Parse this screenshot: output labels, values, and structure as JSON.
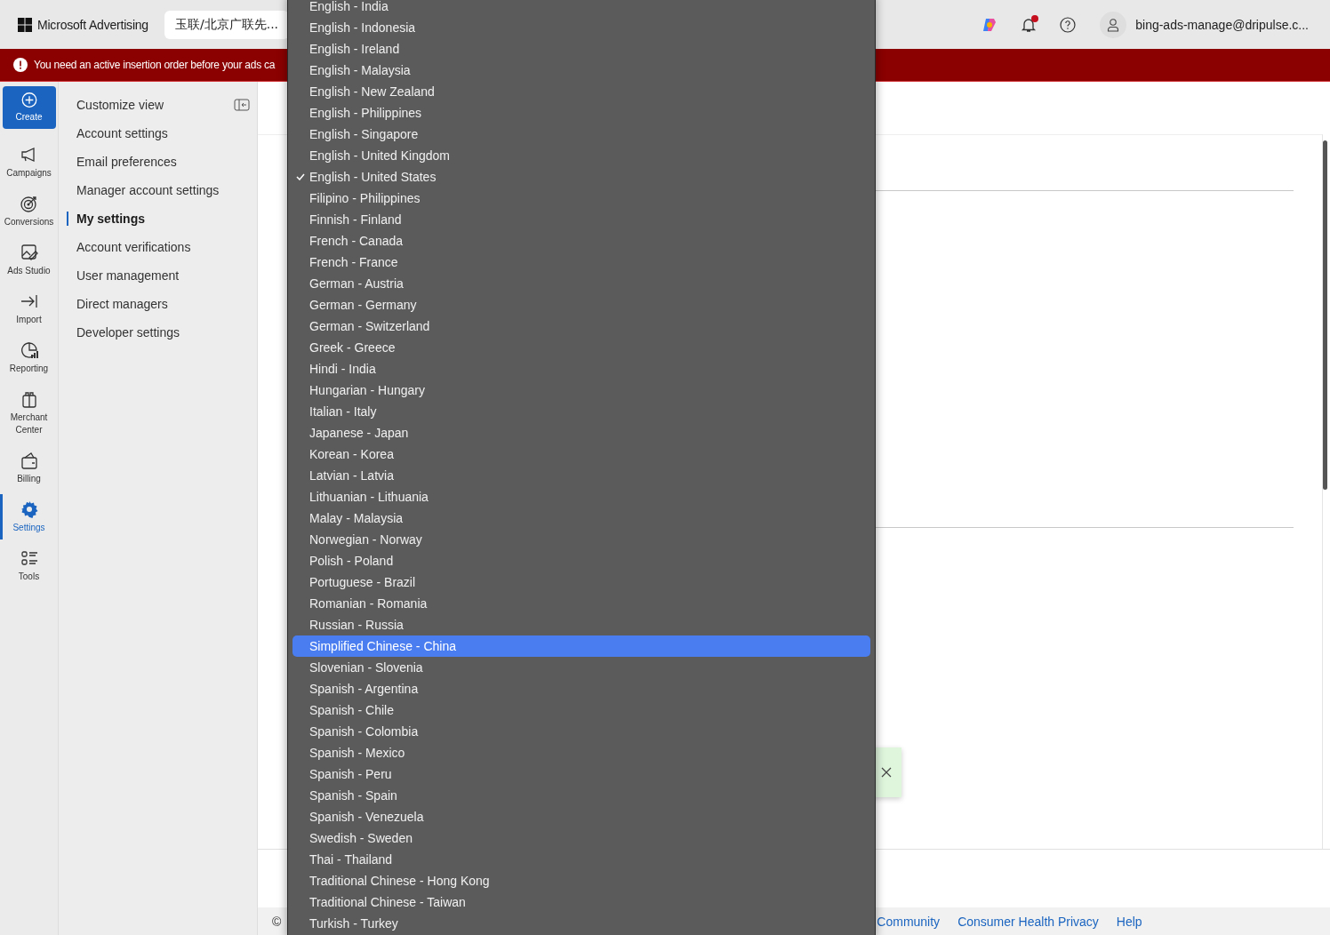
{
  "top_bar": {
    "brand": "Microsoft Advertising",
    "account": "玉联/北京广联先...",
    "user": "bing-ads-manage@dripulse.c...",
    "notifications_unread": true
  },
  "banner": {
    "message": "You need an active insertion order before your ads ca"
  },
  "rail": [
    {
      "label": "Create",
      "kind": "create",
      "selected": false
    },
    {
      "label": "Campaigns",
      "kind": "megaphone",
      "selected": false
    },
    {
      "label": "Conversions",
      "kind": "target",
      "selected": false
    },
    {
      "label": "Ads Studio",
      "kind": "image",
      "selected": false
    },
    {
      "label": "Import",
      "kind": "import",
      "selected": false
    },
    {
      "label": "Reporting",
      "kind": "chart",
      "selected": false
    },
    {
      "label": "Merchant Center",
      "kind": "gift",
      "selected": false
    },
    {
      "label": "Billing",
      "kind": "wallet",
      "selected": false
    },
    {
      "label": "Settings",
      "kind": "gear",
      "selected": true
    },
    {
      "label": "Tools",
      "kind": "list",
      "selected": false
    }
  ],
  "subnav": {
    "header": "Customize view",
    "items": [
      {
        "label": "Account settings",
        "selected": false
      },
      {
        "label": "Email preferences",
        "selected": false
      },
      {
        "label": "Manager account settings",
        "selected": false
      },
      {
        "label": "My settings",
        "selected": true
      },
      {
        "label": "Account verifications",
        "selected": false
      },
      {
        "label": "User management",
        "selected": false
      },
      {
        "label": "Direct managers",
        "selected": false
      },
      {
        "label": "Developer settings",
        "selected": false
      }
    ]
  },
  "footer": {
    "copyright": "©",
    "links": [
      "Community",
      "Consumer Health Privacy",
      "Help"
    ]
  },
  "language_menu": [
    {
      "label": "English - India",
      "checked": false,
      "selected": false
    },
    {
      "label": "English - Indonesia",
      "checked": false,
      "selected": false
    },
    {
      "label": "English - Ireland",
      "checked": false,
      "selected": false
    },
    {
      "label": "English - Malaysia",
      "checked": false,
      "selected": false
    },
    {
      "label": "English - New Zealand",
      "checked": false,
      "selected": false
    },
    {
      "label": "English - Philippines",
      "checked": false,
      "selected": false
    },
    {
      "label": "English - Singapore",
      "checked": false,
      "selected": false
    },
    {
      "label": "English - United Kingdom",
      "checked": false,
      "selected": false
    },
    {
      "label": "English - United States",
      "checked": true,
      "selected": false
    },
    {
      "label": "Filipino - Philippines",
      "checked": false,
      "selected": false
    },
    {
      "label": "Finnish - Finland",
      "checked": false,
      "selected": false
    },
    {
      "label": "French - Canada",
      "checked": false,
      "selected": false
    },
    {
      "label": "French - France",
      "checked": false,
      "selected": false
    },
    {
      "label": "German - Austria",
      "checked": false,
      "selected": false
    },
    {
      "label": "German - Germany",
      "checked": false,
      "selected": false
    },
    {
      "label": "German - Switzerland",
      "checked": false,
      "selected": false
    },
    {
      "label": "Greek - Greece",
      "checked": false,
      "selected": false
    },
    {
      "label": "Hindi - India",
      "checked": false,
      "selected": false
    },
    {
      "label": "Hungarian - Hungary",
      "checked": false,
      "selected": false
    },
    {
      "label": "Italian - Italy",
      "checked": false,
      "selected": false
    },
    {
      "label": "Japanese - Japan",
      "checked": false,
      "selected": false
    },
    {
      "label": "Korean - Korea",
      "checked": false,
      "selected": false
    },
    {
      "label": "Latvian - Latvia",
      "checked": false,
      "selected": false
    },
    {
      "label": "Lithuanian - Lithuania",
      "checked": false,
      "selected": false
    },
    {
      "label": "Malay - Malaysia",
      "checked": false,
      "selected": false
    },
    {
      "label": "Norwegian - Norway",
      "checked": false,
      "selected": false
    },
    {
      "label": "Polish - Poland",
      "checked": false,
      "selected": false
    },
    {
      "label": "Portuguese - Brazil",
      "checked": false,
      "selected": false
    },
    {
      "label": "Romanian - Romania",
      "checked": false,
      "selected": false
    },
    {
      "label": "Russian - Russia",
      "checked": false,
      "selected": false
    },
    {
      "label": "Simplified Chinese - China",
      "checked": false,
      "selected": true
    },
    {
      "label": "Slovenian - Slovenia",
      "checked": false,
      "selected": false
    },
    {
      "label": "Spanish - Argentina",
      "checked": false,
      "selected": false
    },
    {
      "label": "Spanish - Chile",
      "checked": false,
      "selected": false
    },
    {
      "label": "Spanish - Colombia",
      "checked": false,
      "selected": false
    },
    {
      "label": "Spanish - Mexico",
      "checked": false,
      "selected": false
    },
    {
      "label": "Spanish - Peru",
      "checked": false,
      "selected": false
    },
    {
      "label": "Spanish - Spain",
      "checked": false,
      "selected": false
    },
    {
      "label": "Spanish - Venezuela",
      "checked": false,
      "selected": false
    },
    {
      "label": "Swedish - Sweden",
      "checked": false,
      "selected": false
    },
    {
      "label": "Thai - Thailand",
      "checked": false,
      "selected": false
    },
    {
      "label": "Traditional Chinese - Hong Kong",
      "checked": false,
      "selected": false
    },
    {
      "label": "Traditional Chinese - Taiwan",
      "checked": false,
      "selected": false
    },
    {
      "label": "Turkish - Turkey",
      "checked": false,
      "selected": false
    }
  ]
}
